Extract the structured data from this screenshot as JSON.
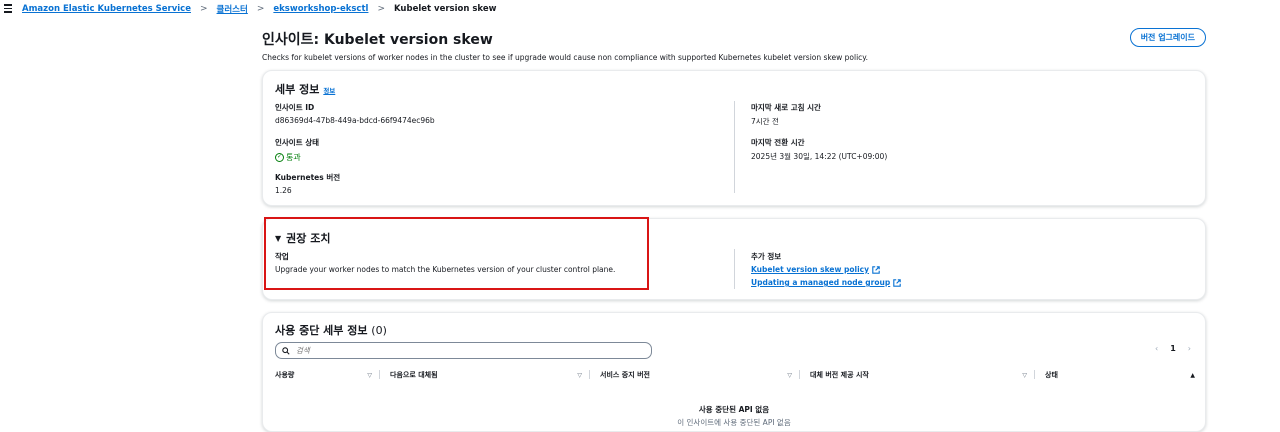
{
  "breadcrumb": {
    "items": [
      "Amazon Elastic Kubernetes Service",
      "클러스터",
      "eksworkshop-eksctl"
    ],
    "current": "Kubelet version skew"
  },
  "header": {
    "title": "인사이트: Kubelet version skew",
    "description": "Checks for kubelet versions of worker nodes in the cluster to see if upgrade would cause non compliance with supported Kubernetes kubelet version skew policy.",
    "upgrade_button": "버전 업그레이드"
  },
  "details": {
    "title": "세부 정보",
    "info_link": "정보",
    "insight_id_label": "인사이트 ID",
    "insight_id": "d86369d4-47b8-449a-bdcd-66f9474ec96b",
    "insight_status_label": "인사이트 상태",
    "insight_status": "통과",
    "k8s_version_label": "Kubernetes 버전",
    "k8s_version": "1.26",
    "last_refresh_label": "마지막 새로 고침 시간",
    "last_refresh": "7시간 전",
    "last_transition_label": "마지막 전환 시간",
    "last_transition": "2025년 3월 30일, 14:22 (UTC+09:00)"
  },
  "recommendation": {
    "title": "권장 조치",
    "action_label": "작업",
    "action_text": "Upgrade your worker nodes to match the Kubernetes version of your cluster control plane.",
    "more_info_label": "추가 정보",
    "links": [
      "Kubelet version skew policy",
      "Updating a managed node group"
    ]
  },
  "deprecation": {
    "title": "사용 중단 세부 정보",
    "count": "(0)",
    "search_placeholder": "검색",
    "page": "1",
    "columns": [
      "사용량",
      "다음으로 대체됨",
      "서비스 중지 버전",
      "대체 버전 제공 시작",
      "상태"
    ],
    "empty_title": "사용 중단된 API 없음",
    "empty_desc": "이 인사이트에 사용 중단된 API 없음"
  },
  "colors": {
    "link": "#0972d3",
    "success": "#037f0c",
    "highlight": "#d91515"
  }
}
